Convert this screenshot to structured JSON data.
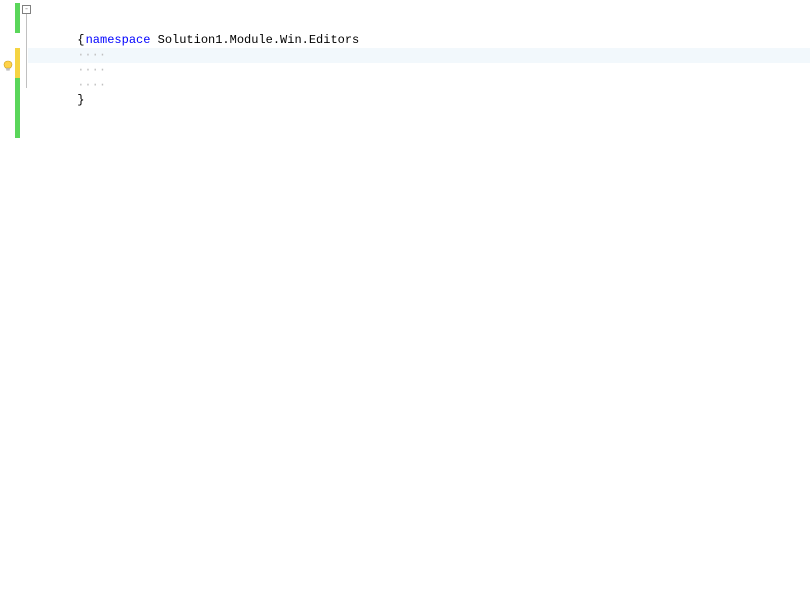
{
  "colors": {
    "keyword": "#0000ff",
    "plain": "#000000",
    "changeSaved": "#5ad65a",
    "changeUnsaved": "#f5d442",
    "highlight": "#f2f8fc"
  },
  "icons": {
    "lightbulb": "lightbulb-icon",
    "outlineMinus": "-"
  },
  "code": {
    "keyword_namespace": "namespace",
    "namespace_name": " Solution1.Module.Win.Editors",
    "brace_open": "{",
    "brace_close": "}",
    "indent_guide": "····",
    "blank": ""
  },
  "lines": [
    {
      "type": "ns"
    },
    {
      "type": "open"
    },
    {
      "type": "blank"
    },
    {
      "type": "cursor"
    },
    {
      "type": "blank"
    },
    {
      "type": "close"
    }
  ]
}
